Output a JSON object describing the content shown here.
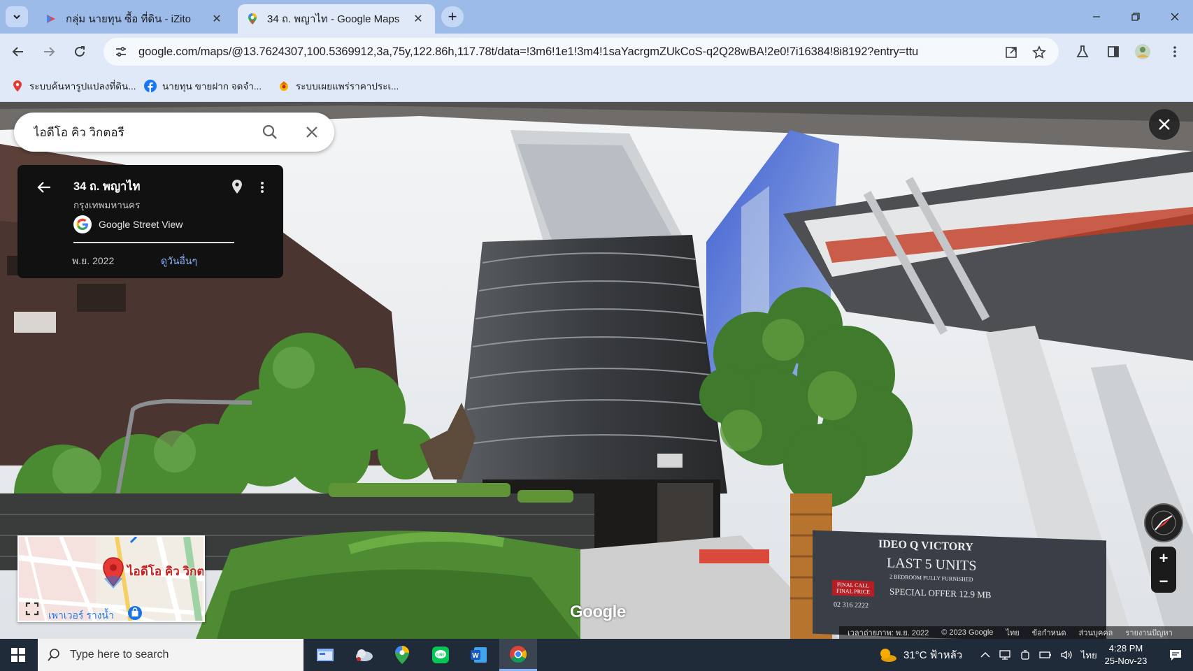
{
  "browser": {
    "tabs": [
      {
        "title": "กลุ่ม นายทุน ซื้อ ที่ดิน - iZito",
        "active": false
      },
      {
        "title": "34 ถ. พญาไท - Google Maps",
        "active": true
      }
    ],
    "url": "google.com/maps/@13.7624307,100.5369912,3a,75y,122.86h,117.78t/data=!3m6!1e1!3m4!1saYacrgmZUkCoS-q2Q28wBA!2e0!7i16384!8i8192?entry=ttu",
    "bookmarks": [
      {
        "label": "ระบบค้นหารูปแปลงที่ดิน...",
        "icon": "map-pin-icon"
      },
      {
        "label": "นายทุน ขายฝาก จดจำ...",
        "icon": "facebook-icon"
      },
      {
        "label": "ระบบเผยแพร่ราคาประเ...",
        "icon": "government-seal-icon"
      }
    ]
  },
  "maps": {
    "search": {
      "value": "ไอดีโอ คิว วิกตอรี"
    },
    "card": {
      "address": "34 ถ. พญาไท",
      "city": "กรุงเทพมหานคร",
      "source": "Google Street View",
      "date": "พ.ย. 2022",
      "more_dates": "ดูวันอื่นๆ"
    },
    "minimap": {
      "place_label": "ไอดีโอ คิว วิกตอ",
      "street_label": "เพาเวอร์ รางน้ำ"
    },
    "watermark": "Google",
    "footer": {
      "capture_date": "เวลาถ่ายภาพ: พ.ย. 2022",
      "copyright": "© 2023 Google",
      "language": "ไทย",
      "terms": "ข้อกำหนด",
      "privacy": "ส่วนบุคคล",
      "report": "รายงานปัญหา"
    },
    "billboard": {
      "line1": "IDEO Q VICTORY",
      "line2": "LAST 5 UNITS",
      "line3": "2 BEDROOM FULLY FURNISHED",
      "line4": "SPECIAL OFFER 12.9 MB",
      "phone": "02 316 2222",
      "tag": "FINAL CALL FINAL PRICE"
    }
  },
  "taskbar": {
    "search_placeholder": "Type here to search",
    "weather": "31°C  ฟ้าหลัว",
    "language": "ไทย",
    "time": "4:28 PM",
    "date": "25-Nov-23"
  },
  "colors": {
    "tabbar": "#9cbbe8",
    "toolbar": "#dfe9f8",
    "card_bg": "#111111",
    "link": "#8ab4f8",
    "taskbar": "#202b3a"
  }
}
